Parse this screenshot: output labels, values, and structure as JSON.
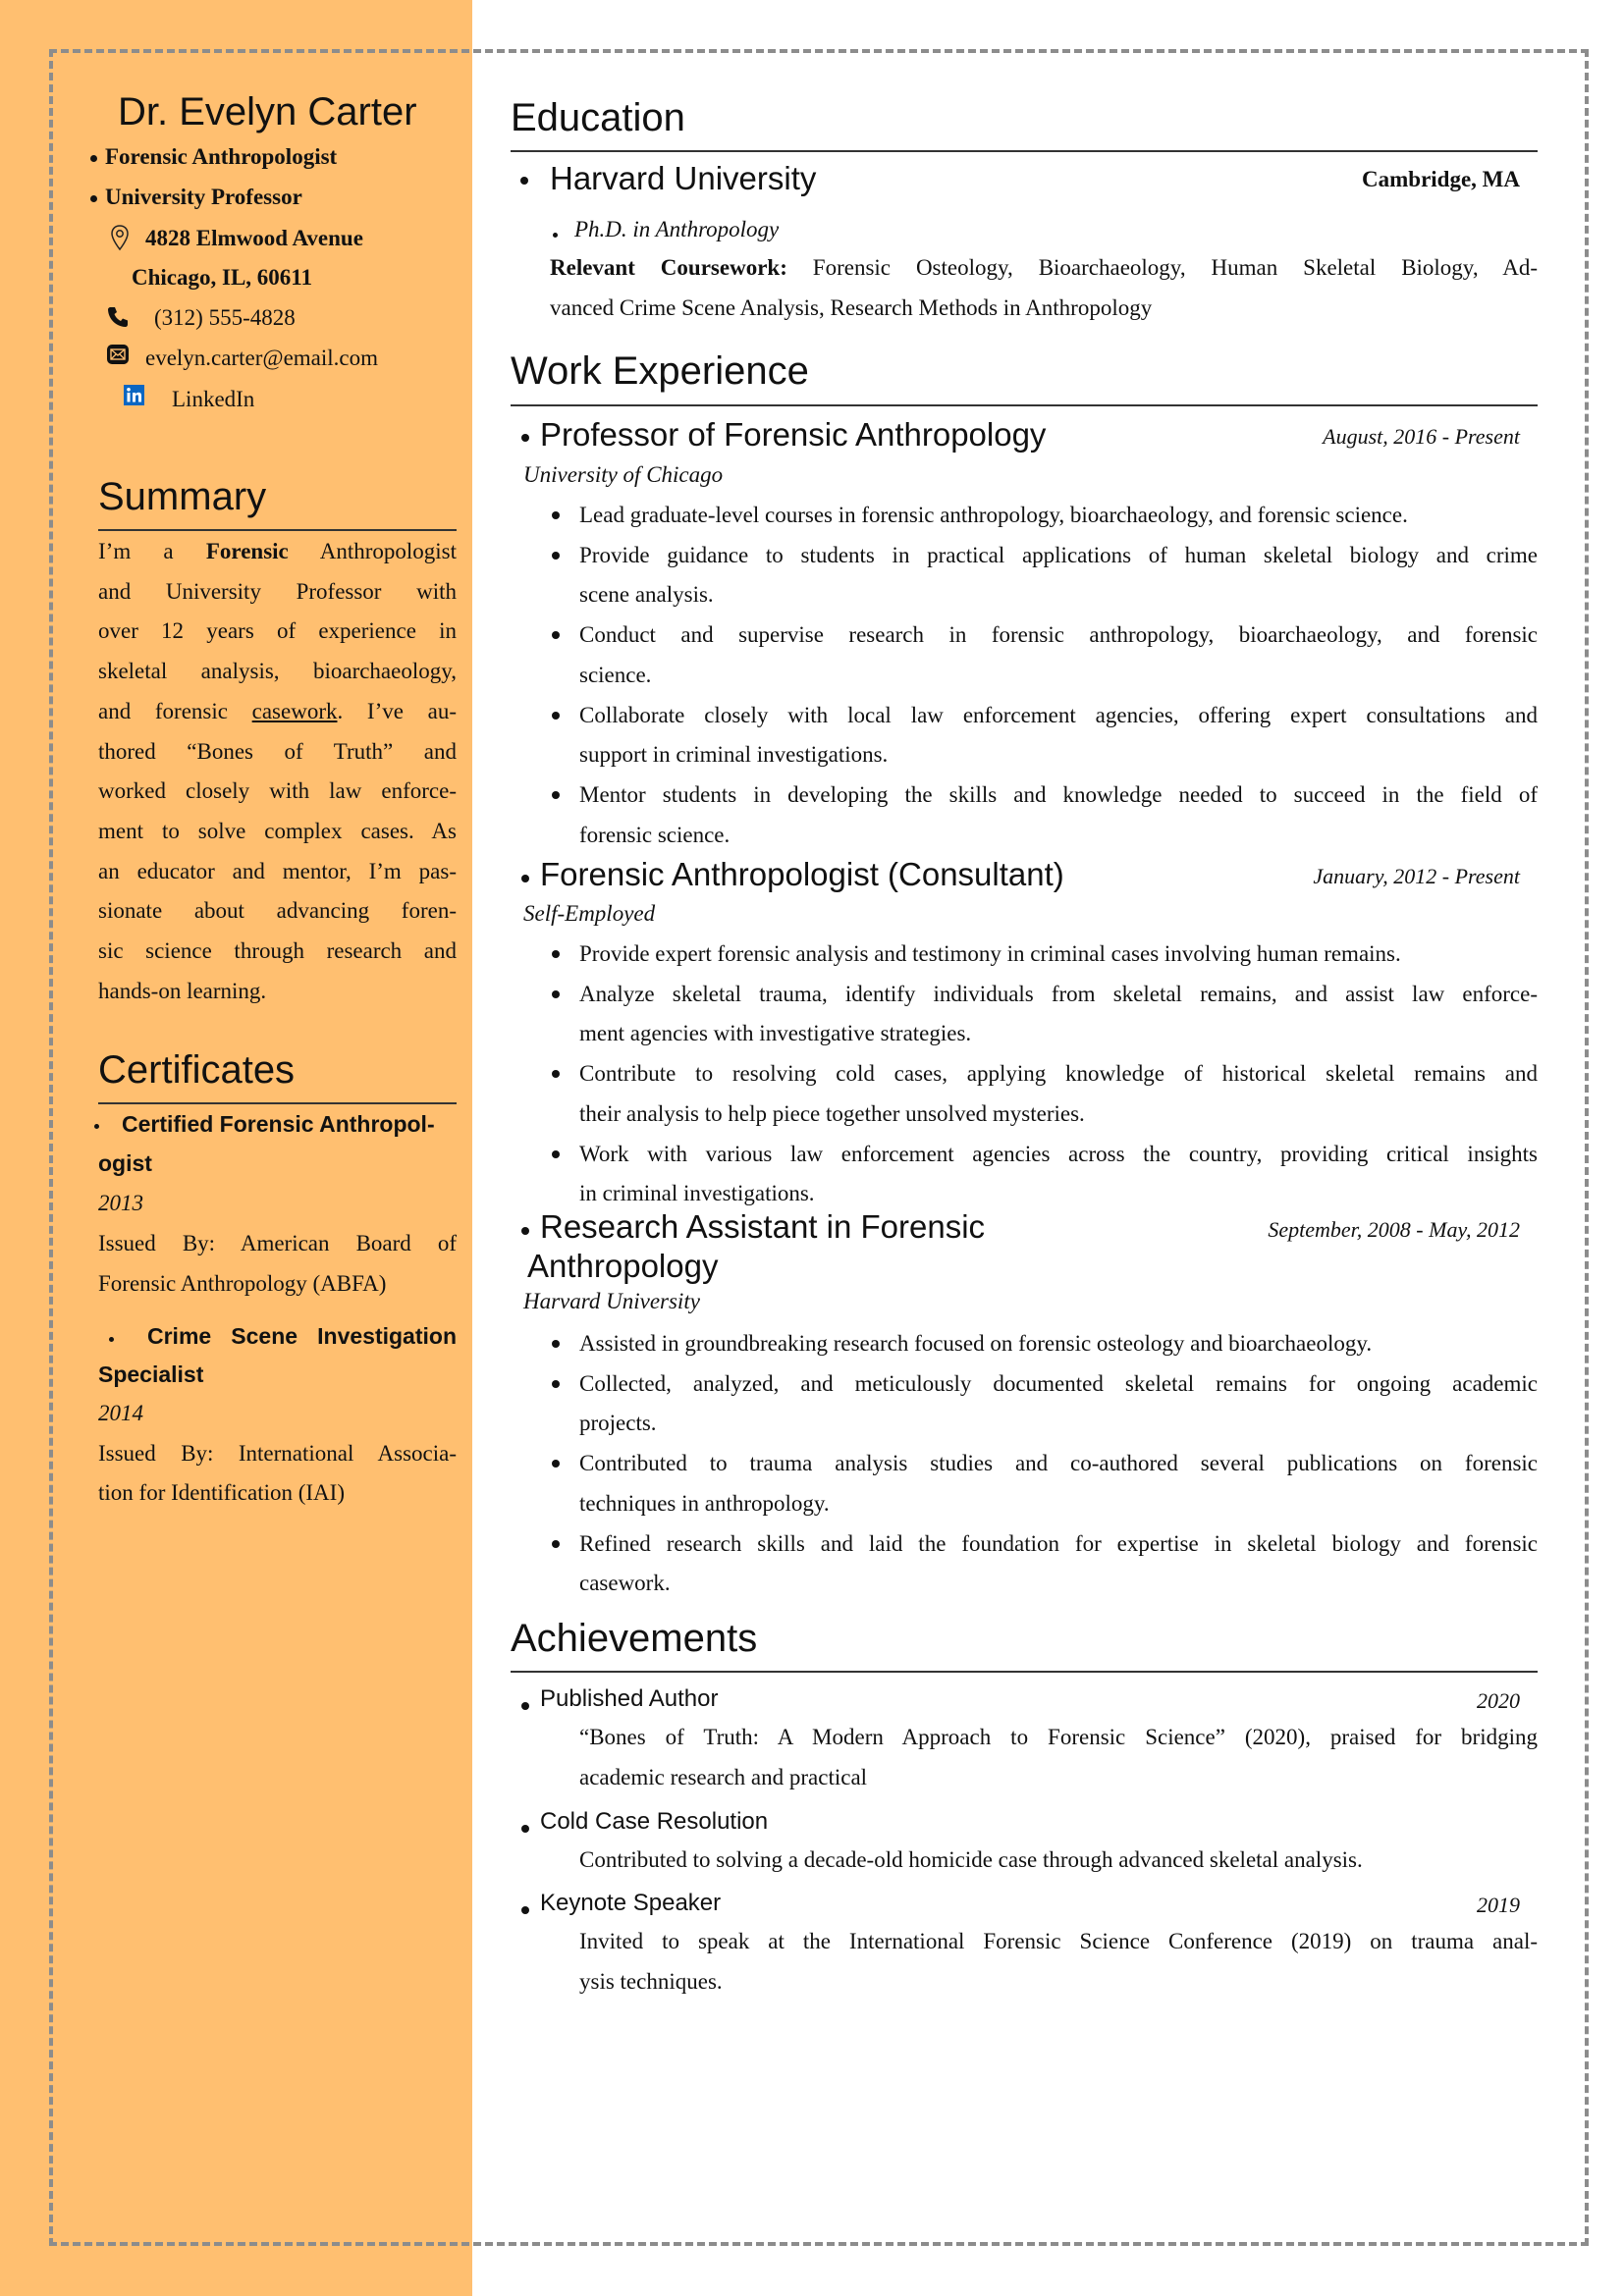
{
  "header": {
    "name": "Dr. Evelyn Carter",
    "titles": [
      "Forensic Anthropologist",
      "University Professor"
    ],
    "address_line1": "4828 Elmwood Avenue",
    "address_line2": "Chicago, IL, 60611",
    "phone": "(312) 555-4828",
    "email": "evelyn.carter@email.com",
    "linkedin": "LinkedIn",
    "icons": {
      "address": "map-pin-icon",
      "phone": "phone-icon",
      "email": "envelope-icon",
      "linkedin": "linkedin-icon"
    }
  },
  "colors": {
    "sidebar": "#FFBF70",
    "frame": "#8c8c8c",
    "linkedin": "#0A66C2"
  },
  "summary": {
    "heading": "Summary",
    "lines": [
      [
        "I’m a ",
        "Forensic",
        " Anthropologist"
      ],
      "and University Professor with",
      "over 12 years of experience in",
      "skeletal analysis, bioarchaeology,",
      [
        "and forensic ",
        "casework",
        ".  I’ve au-"
      ],
      "thored “Bones of Truth” and",
      "worked closely with law enforce-",
      "ment to solve complex cases.  As",
      "an educator and mentor, I’m pas-",
      "sionate about advancing foren-",
      "sic science through research and",
      "hands-on learning."
    ],
    "bold_word": "Forensic",
    "underlined_word": "casework"
  },
  "certificates": {
    "heading": "Certificates",
    "items": [
      {
        "title_l1": "Certified Forensic Anthropol-",
        "title_l2": "ogist",
        "year": "2013",
        "issued_l1": "Issued By:  American Board of",
        "issued_l2": "Forensic Anthropology (ABFA)"
      },
      {
        "title_l1": "Crime Scene Investigation",
        "title_l2": "Specialist",
        "year": "2014",
        "issued_l1": "Issued By: International Associa-",
        "issued_l2": "tion for Identification (IAI)"
      }
    ]
  },
  "education": {
    "heading": "Education",
    "school": "Harvard University",
    "location": "Cambridge, MA",
    "degree": "Ph.D. in Anthropology",
    "coursework_label": "Relevant Coursework:",
    "coursework_l1": " Forensic Osteology, Bioarchaeology, Human Skeletal Biology, Ad-",
    "coursework_l2": "vanced Crime Scene Analysis, Research Methods in Anthropology"
  },
  "work": {
    "heading": "Work Experience",
    "jobs": [
      {
        "title": "Professor of Forensic Anthropology",
        "dates": "August, 2016 - Present",
        "org": "University of Chicago",
        "bullets": [
          [
            "Lead graduate-level courses in forensic anthropology, bioarchaeology, and forensic science."
          ],
          [
            "Provide guidance to students in practical applications of human skeletal biology and crime",
            "scene analysis."
          ],
          [
            "Conduct and supervise research in forensic anthropology, bioarchaeology, and forensic",
            "science."
          ],
          [
            "Collaborate closely with local law enforcement agencies, offering expert consultations and",
            "support in criminal investigations."
          ],
          [
            "Mentor students in developing the skills and knowledge needed to succeed in the field of",
            "forensic science."
          ]
        ]
      },
      {
        "title": "Forensic Anthropologist (Consultant)",
        "dates": "January, 2012 - Present",
        "org": "Self-Employed",
        "bullets": [
          [
            "Provide expert forensic analysis and testimony in criminal cases involving human remains."
          ],
          [
            "Analyze skeletal trauma, identify individuals from skeletal remains, and assist law enforce-",
            "ment agencies with investigative strategies."
          ],
          [
            "Contribute to resolving cold cases, applying knowledge of historical skeletal remains and",
            "their analysis to help piece together unsolved mysteries."
          ],
          [
            "Work with various law enforcement agencies across the country, providing critical insights",
            "in criminal investigations."
          ]
        ]
      },
      {
        "title_l1": "Research Assistant in Forensic",
        "title_l2": "Anthropology",
        "dates": "September, 2008 - May, 2012",
        "org": "Harvard University",
        "bullets": [
          [
            "Assisted in groundbreaking research focused on forensic osteology and bioarchaeology."
          ],
          [
            "Collected, analyzed, and meticulously documented skeletal remains for ongoing academic",
            "projects."
          ],
          [
            "Contributed to trauma analysis studies and co-authored several publications on forensic",
            "techniques in anthropology."
          ],
          [
            "Refined research skills and laid the foundation for expertise in skeletal biology and forensic",
            "casework."
          ]
        ]
      }
    ]
  },
  "achievements": {
    "heading": "Achievements",
    "items": [
      {
        "title": "Published Author",
        "year": "2020",
        "lines": [
          "“Bones of Truth: A Modern Approach to Forensic Science” (2020), praised for bridging",
          "academic research and practical"
        ]
      },
      {
        "title": "Cold Case Resolution",
        "year": "",
        "lines": [
          "Contributed to solving a decade-old homicide case through advanced skeletal analysis."
        ]
      },
      {
        "title": "Keynote Speaker",
        "year": "2019",
        "lines": [
          "Invited to speak at the International Forensic Science Conference (2019) on trauma anal-",
          "ysis techniques."
        ]
      }
    ]
  }
}
